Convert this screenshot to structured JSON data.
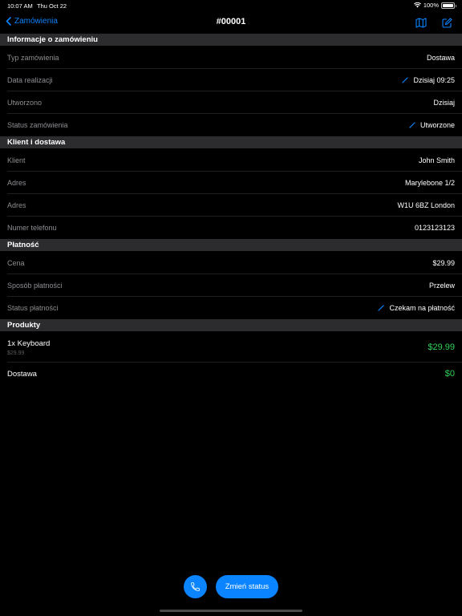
{
  "status_bar": {
    "time": "10:07 AM",
    "date": "Thu Oct 22",
    "battery": "100%"
  },
  "nav": {
    "back_label": "Zamówienia",
    "title": "#00001"
  },
  "sections": {
    "order_info": {
      "title": "Informacje o zamówieniu",
      "rows": [
        {
          "label": "Typ zamówienia",
          "value": "Dostawa",
          "editable": false
        },
        {
          "label": "Data realizacji",
          "value": "Dzisiaj 09:25",
          "editable": true
        },
        {
          "label": "Utworzono",
          "value": "Dzisiaj",
          "editable": false
        },
        {
          "label": "Status zamówienia",
          "value": "Utworzone",
          "editable": true
        }
      ]
    },
    "client": {
      "title": "Klient i dostawa",
      "rows": [
        {
          "label": "Klient",
          "value": "John Smith"
        },
        {
          "label": "Adres",
          "value": "Marylebone 1/2"
        },
        {
          "label": "Adres",
          "value": "W1U 6BZ London"
        },
        {
          "label": "Numer telefonu",
          "value": "0123123123"
        }
      ]
    },
    "payment": {
      "title": "Płatność",
      "rows": [
        {
          "label": "Cena",
          "value": "$29.99",
          "editable": false
        },
        {
          "label": "Sposób płatności",
          "value": "Przelew",
          "editable": false
        },
        {
          "label": "Status płatności",
          "value": "Czekam na płatność",
          "editable": true
        }
      ]
    },
    "products": {
      "title": "Produkty",
      "items": [
        {
          "name": "1x Keyboard",
          "unit_price": "$29.99",
          "total": "$29.99"
        }
      ],
      "delivery": {
        "name": "Dostawa",
        "price": "$0"
      }
    }
  },
  "actions": {
    "change_status_label": "Zmień status"
  },
  "colors": {
    "accent": "#0a84ff",
    "price_green": "#30d158",
    "section_bg": "#2c2c2e"
  },
  "icons": {
    "back": "chevron-left-icon",
    "map": "map-icon",
    "edit": "compose-icon",
    "pencil": "pencil-icon",
    "phone": "phone-icon"
  }
}
